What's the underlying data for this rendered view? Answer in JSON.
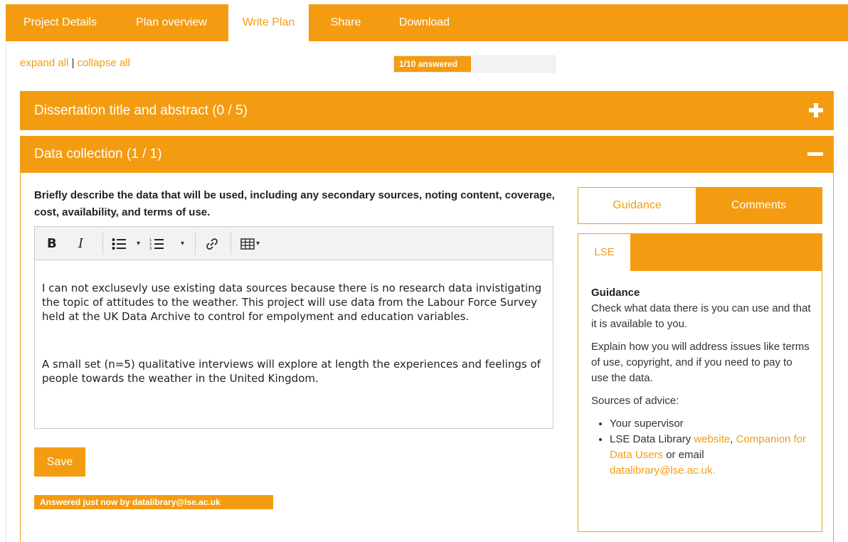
{
  "tabs": [
    {
      "label": "Project Details"
    },
    {
      "label": "Plan overview"
    },
    {
      "label": "Write Plan"
    },
    {
      "label": "Share"
    },
    {
      "label": "Download"
    }
  ],
  "expand_all": "expand all",
  "separator": "|",
  "collapse_all": "collapse all",
  "progress": {
    "label": "1/10 answered",
    "fraction": 0.1
  },
  "sections": [
    {
      "title": "Dissertation title and abstract (0 / 5)",
      "expanded": false
    },
    {
      "title": "Data collection (1 / 1)",
      "expanded": true
    }
  ],
  "question": "Briefly describe the data that will be used, including any secondary sources, noting content, coverage, cost, availability, and terms of use.",
  "toolbar": {
    "bold": "B",
    "italic": "I",
    "caret": "▾"
  },
  "answer": [
    "I can not exclusevly use existing data sources because there is no research data invistigating the topic of attitudes to the weather. This project will use data from the Labour Force Survey held at the UK Data Archive to control for empolyment and education variables.",
    "A small set (n=5) qualitative interviews will explore at length the experiences and feelings of people towards the weather in the United Kingdom."
  ],
  "save_label": "Save",
  "answered_status": "Answered just now by datalibrary@lse.ac.uk",
  "guidance_tabs": {
    "guidance": "Guidance",
    "comments": "Comments"
  },
  "org_tab": "LSE",
  "guidance": {
    "title": "Guidance",
    "p1": "Check what data there is you can use and that it is available to you.",
    "p2": "Explain how you will address issues like terms of use, copyright, and if you need to pay to use the data.",
    "p3": "Sources of advice:",
    "item1": "Your supervisor",
    "item2_prefix": "LSE Data Library ",
    "item2_link1": "website",
    "item2_comma": ",",
    "item2_link2": "Companion for Data Users",
    "item2_or": " or email ",
    "item2_link3": "datalibrary@lse.ac.uk."
  },
  "colors": {
    "accent": "#f39c12",
    "background": "#ffffff",
    "text": "#333333"
  }
}
